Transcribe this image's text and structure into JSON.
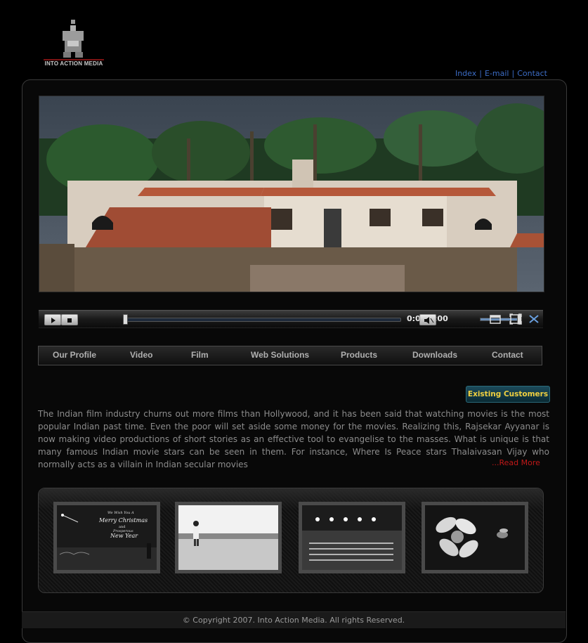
{
  "brand": {
    "logo_text": "INTO ACTION MEDIA"
  },
  "top_links": [
    {
      "label": "Index"
    },
    {
      "label": "E-mail"
    },
    {
      "label": "Contact"
    }
  ],
  "player": {
    "time": "0:00/0:00",
    "progress": 0,
    "volume": 1.0
  },
  "nav": [
    {
      "label": "Our Profile"
    },
    {
      "label": "Video"
    },
    {
      "label": "Film"
    },
    {
      "label": "Web Solutions"
    },
    {
      "label": "Products"
    },
    {
      "label": "Downloads"
    },
    {
      "label": "Contact"
    }
  ],
  "customers_button": "Existing Customers",
  "intro": {
    "text": "The Indian film industry churns out more films than Hollywood, and it has been said that watching movies is the most popular Indian past time. Even the poor will set aside some money for the movies. Realizing this, Rajsekar Ayyanar is now making video productions of short stories as an effective tool to evangelise to the masses. What is unique is that many famous Indian movie stars can be seen in them. For instance, Where Is Peace stars Thalaivasan Vijay who normally acts as a villain in Indian secular movies",
    "read_more": "...Read More"
  },
  "gallery": {
    "card_lines": [
      "We Wish You A",
      "Merry Christmas",
      "and",
      "Prosperous",
      "New Year"
    ]
  },
  "footer": "© Copyright 2007. Into Action Media. All rights Reserved."
}
